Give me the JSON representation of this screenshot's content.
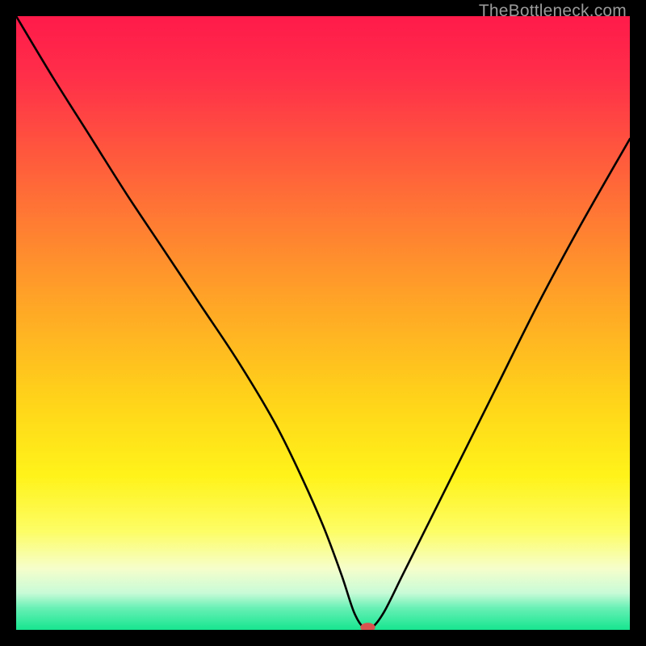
{
  "watermark": "TheBottleneck.com",
  "chart_data": {
    "type": "line",
    "title": "",
    "xlabel": "",
    "ylabel": "",
    "xlim": [
      0,
      100
    ],
    "ylim": [
      0,
      100
    ],
    "grid": false,
    "legend": false,
    "gradient_stops": [
      {
        "offset": 0.0,
        "color": "#ff1a4a"
      },
      {
        "offset": 0.1,
        "color": "#ff2f49"
      },
      {
        "offset": 0.28,
        "color": "#ff6a38"
      },
      {
        "offset": 0.45,
        "color": "#ffa028"
      },
      {
        "offset": 0.62,
        "color": "#ffd21a"
      },
      {
        "offset": 0.75,
        "color": "#fff31a"
      },
      {
        "offset": 0.84,
        "color": "#fdfd66"
      },
      {
        "offset": 0.9,
        "color": "#f6fecb"
      },
      {
        "offset": 0.94,
        "color": "#c8fbd7"
      },
      {
        "offset": 0.965,
        "color": "#66f0b4"
      },
      {
        "offset": 1.0,
        "color": "#17e58f"
      }
    ],
    "series": [
      {
        "name": "curve",
        "stroke": "#000000",
        "stroke_width": 2.6,
        "x": [
          0,
          6,
          12,
          18,
          24,
          30,
          36,
          42,
          46,
          50,
          53,
          55,
          56.5,
          58,
          60,
          63,
          67,
          72,
          78,
          85,
          92,
          100
        ],
        "y": [
          100,
          90,
          80.5,
          71,
          62,
          53,
          44,
          34,
          26,
          17,
          9,
          3,
          0.5,
          0.4,
          3,
          9,
          17,
          27,
          39,
          53,
          66,
          80
        ]
      }
    ],
    "marker": {
      "x": 57.3,
      "y_top": 0.4,
      "rx": 1.2,
      "ry": 0.75,
      "fill": "#d9534f"
    }
  }
}
